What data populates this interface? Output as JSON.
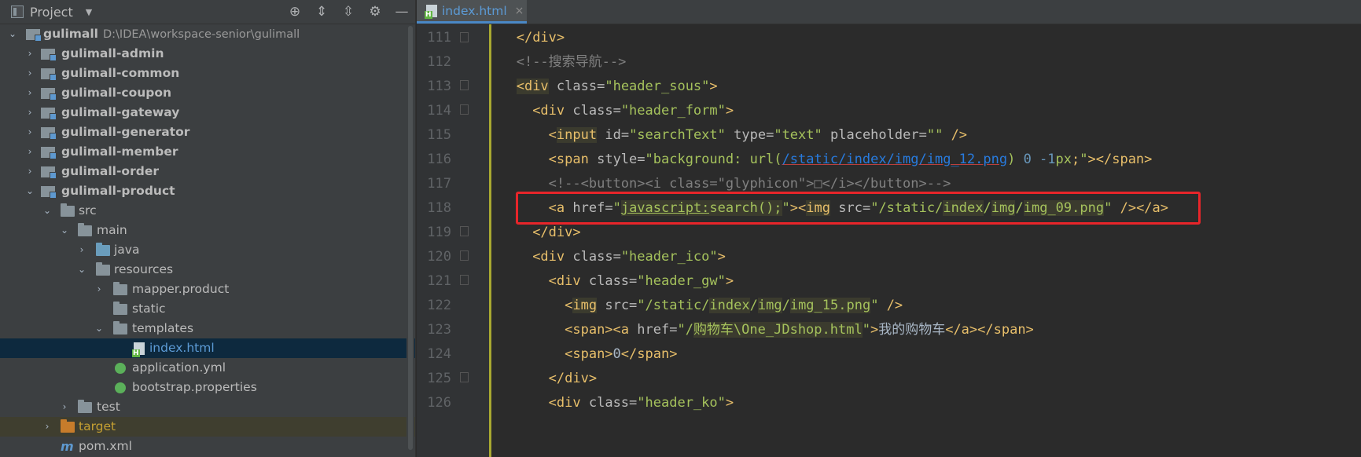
{
  "panel": {
    "title": "Project"
  },
  "tree": [
    {
      "label": "gulimall",
      "path": "D:\\IDEA\\workspace-senior\\gulimall"
    },
    {
      "label": "gulimall-admin"
    },
    {
      "label": "gulimall-common"
    },
    {
      "label": "gulimall-coupon"
    },
    {
      "label": "gulimall-gateway"
    },
    {
      "label": "gulimall-generator"
    },
    {
      "label": "gulimall-member"
    },
    {
      "label": "gulimall-order"
    },
    {
      "label": "gulimall-product"
    },
    {
      "label": "src"
    },
    {
      "label": "main"
    },
    {
      "label": "java"
    },
    {
      "label": "resources"
    },
    {
      "label": "mapper.product"
    },
    {
      "label": "static"
    },
    {
      "label": "templates"
    },
    {
      "label": "index.html"
    },
    {
      "label": "application.yml"
    },
    {
      "label": "bootstrap.properties"
    },
    {
      "label": "test"
    },
    {
      "label": "target"
    },
    {
      "label": "pom.xml"
    }
  ],
  "editor": {
    "tab": {
      "label": "index.html",
      "close": "×"
    },
    "line_numbers": [
      "111",
      "112",
      "113",
      "114",
      "115",
      "116",
      "117",
      "118",
      "119",
      "120",
      "121",
      "122",
      "123",
      "124",
      "125",
      "126"
    ],
    "highlight_line": "118"
  },
  "colors": {
    "highlight_box": "#e8252a",
    "selection": "#0d293e"
  },
  "icons": [
    "project-icon",
    "locate-icon",
    "expand-all-icon",
    "collapse-all-icon",
    "gear-icon",
    "minimize-icon",
    "folder-icon",
    "module-icon",
    "html-file-icon",
    "spring-config-icon",
    "maven-icon",
    "fold-marker-icon"
  ]
}
